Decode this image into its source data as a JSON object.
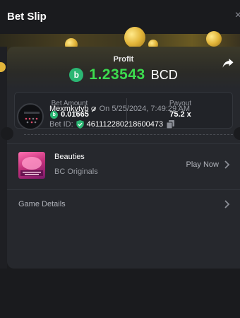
{
  "header": {
    "title": "Bet Slip",
    "close_glyph": "×"
  },
  "result": {
    "profit_label": "Profit",
    "profit_value": "1.23543",
    "currency": "BCD",
    "currency_icon_letter": "b"
  },
  "stats": {
    "bet_amount_label": "Bet Amount",
    "bet_amount_value": "0.01665",
    "payout_label": "Payout",
    "payout_value": "75.2 x"
  },
  "bet_info": {
    "username": "Mexmkytyb",
    "timestamp": "On 5/25/2024, 7:49:29 AM",
    "bet_id_label": "Bet ID:",
    "bet_id": "461112280218600473"
  },
  "game": {
    "name": "Beauties",
    "category": "BC Originals",
    "play_label": "Play Now"
  },
  "footer": {
    "details_label": "Game Details"
  },
  "icons": [
    "close-icon",
    "share-icon",
    "bcd-coin-icon",
    "verified-shield-icon",
    "copy-icon",
    "chevron-right-icon"
  ],
  "colors": {
    "profit_green": "#3cdb4e",
    "coin_green": "#2bb673",
    "background": "#1a1b1e",
    "card": "#26282d"
  }
}
